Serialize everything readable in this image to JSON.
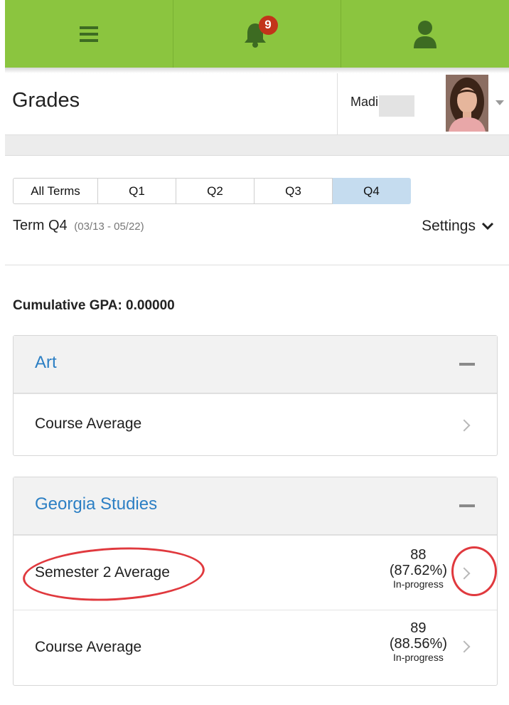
{
  "topbar": {
    "menu_icon": "hamburger-menu-icon",
    "notification_icon": "bell-icon",
    "notification_count": "9",
    "profile_icon": "person-icon",
    "color": "#8bc53f"
  },
  "header": {
    "title": "Grades",
    "user_name": "Madi"
  },
  "terms": {
    "tabs": [
      "All Terms",
      "Q1",
      "Q2",
      "Q3",
      "Q4"
    ],
    "active": "Q4",
    "current_label": "Term Q4",
    "current_dates": "(03/13 - 05/22)",
    "settings_label": "Settings"
  },
  "gpa": "Cumulative GPA: 0.00000",
  "courses": [
    {
      "name": "Art",
      "rows": [
        {
          "label": "Course Average"
        }
      ]
    },
    {
      "name": "Georgia Studies",
      "rows": [
        {
          "label": "Semester 2 Average",
          "score": "88",
          "percent": "(87.62%)",
          "status": "In-progress"
        },
        {
          "label": "Course Average",
          "score": "89",
          "percent": "(88.56%)",
          "status": "In-progress"
        }
      ]
    }
  ],
  "colors": {
    "link": "#2c7fc4",
    "active_tab": "#c5dcef",
    "annotation": "#e0393e"
  }
}
